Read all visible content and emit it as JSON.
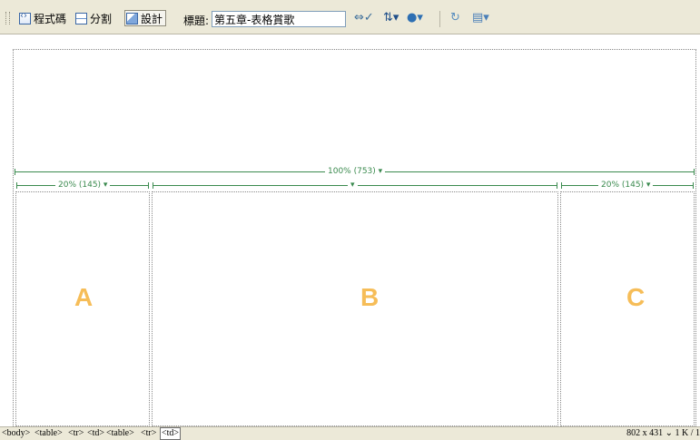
{
  "toolbar": {
    "code_label": "程式碼",
    "split_label": "分割",
    "design_label": "設計",
    "title_label": "標題:",
    "title_value": "第五章-表格賞歌"
  },
  "rulers": {
    "full": "100% (753) ▾",
    "left": "20% (145) ▾",
    "center": "▾",
    "right": "20% (145) ▾"
  },
  "cells": [
    {
      "letter": "A"
    },
    {
      "letter": "B"
    },
    {
      "letter": "C"
    }
  ],
  "colors": {
    "ruler": "#3a8a4e",
    "letter": "#f6bd58"
  },
  "status": {
    "tags": [
      "<body>",
      "<table>",
      "<tr>",
      "<td>",
      "<table>",
      "<tr>",
      "<td>"
    ],
    "selected_tag": "<td>",
    "size": "802 x 431 ⌄ 1 K / 1"
  }
}
